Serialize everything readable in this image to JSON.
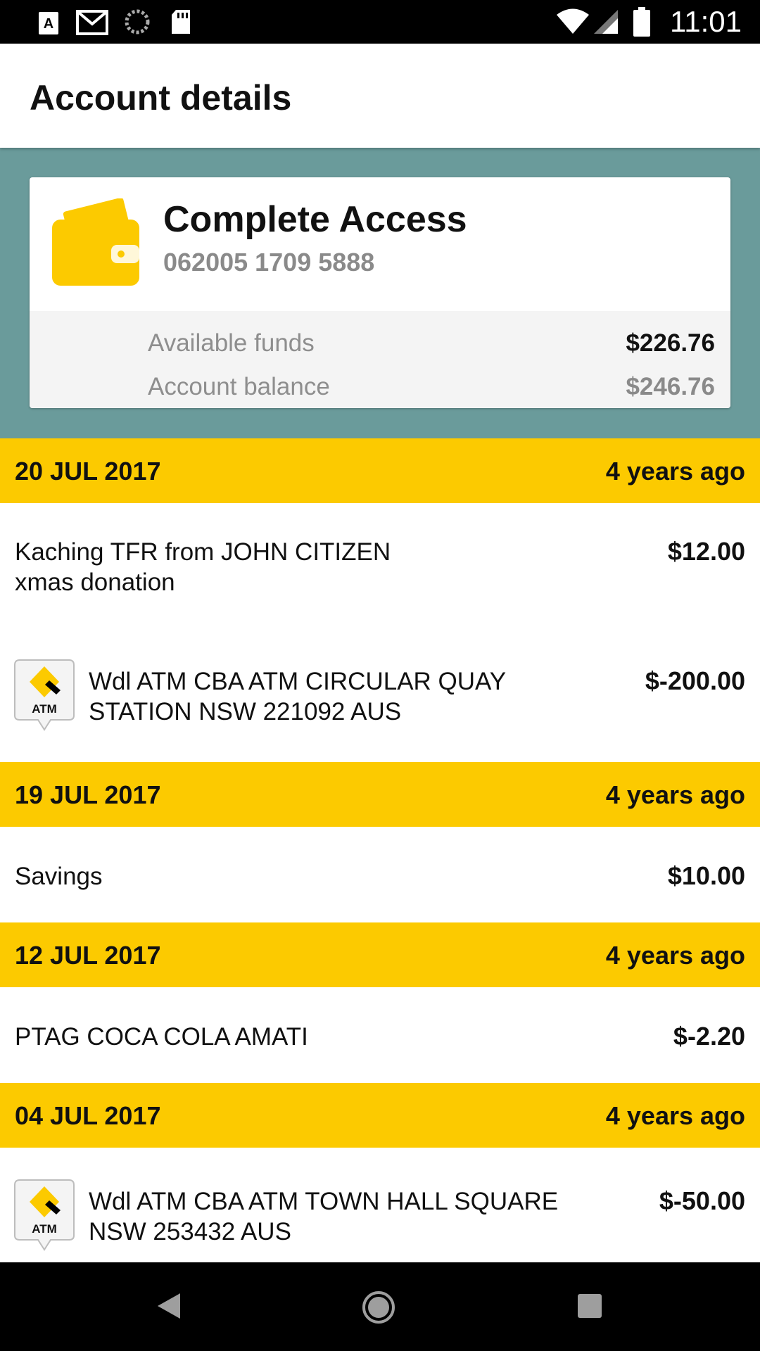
{
  "status_bar": {
    "time": "11:01",
    "icons": [
      "keyboard-icon",
      "gmail-icon",
      "sync-icon",
      "sd-card-icon",
      "wifi-icon",
      "signal-icon",
      "battery-icon"
    ]
  },
  "app_bar": {
    "title": "Account details"
  },
  "account": {
    "name": "Complete Access",
    "number": "062005 1709 5888",
    "available_label": "Available funds",
    "available_value": "$226.76",
    "balance_label": "Account balance",
    "balance_value": "$246.76",
    "icon": "wallet-icon"
  },
  "transactions": [
    {
      "date": "20 JUL 2017",
      "ago": "4 years ago",
      "items": [
        {
          "desc": "Kaching TFR from JOHN CITIZEN\nxmas donation",
          "amount": "$12.00"
        },
        {
          "desc": "Wdl ATM CBA ATM CIRCULAR QUAY\nSTATION NSW 221092 AUS",
          "amount": "$-200.00",
          "badge": "ATM"
        }
      ]
    },
    {
      "date": "19 JUL 2017",
      "ago": "4 years ago",
      "items": [
        {
          "desc": "Savings",
          "amount": "$10.00"
        }
      ]
    },
    {
      "date": "12 JUL 2017",
      "ago": "4 years ago",
      "items": [
        {
          "desc": "PTAG COCA COLA AMATI",
          "amount": "$-2.20"
        }
      ]
    },
    {
      "date": "04 JUL 2017",
      "ago": "4 years ago",
      "items": [
        {
          "desc": "Wdl ATM CBA ATM TOWN HALL SQUARE\nNSW 253432 AUS",
          "amount": "$-50.00",
          "badge": "ATM"
        }
      ]
    }
  ],
  "colors": {
    "accent_yellow": "#fcca00",
    "summary_bg": "#6a9b9b",
    "muted_text": "#8e8e8e"
  }
}
